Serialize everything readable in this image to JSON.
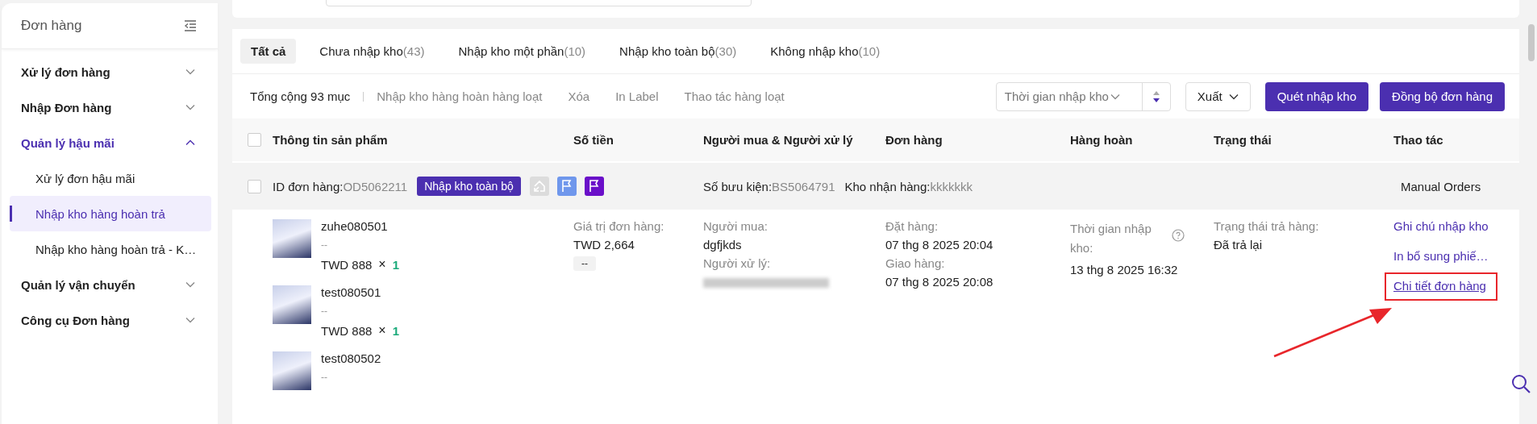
{
  "sidebar": {
    "title": "Đơn hàng",
    "groups": [
      {
        "label": "Xử lý đơn hàng",
        "expanded": false,
        "selected": false
      },
      {
        "label": "Nhập Đơn hàng",
        "expanded": false,
        "selected": false
      },
      {
        "label": "Quản lý hậu mãi",
        "expanded": true,
        "selected": true,
        "children": [
          {
            "label": "Xử lý đơn hậu mãi",
            "selected": false
          },
          {
            "label": "Nhập kho hàng hoàn trả",
            "selected": true
          },
          {
            "label": "Nhập kho hàng hoàn trả - K…",
            "selected": false
          }
        ]
      },
      {
        "label": "Quản lý vận chuyển",
        "expanded": false,
        "selected": false
      },
      {
        "label": "Công cụ Đơn hàng",
        "expanded": false,
        "selected": false
      }
    ]
  },
  "tabs": [
    {
      "label": "Tất cả",
      "selected": true
    },
    {
      "label": "Chưa nhập kho",
      "count": "(43)",
      "selected": false
    },
    {
      "label": "Nhập kho một phần",
      "count": "(10)",
      "selected": false
    },
    {
      "label": "Nhập kho toàn bộ",
      "count": "(30)",
      "selected": false
    },
    {
      "label": "Không nhập kho",
      "count": "(10)",
      "selected": false
    }
  ],
  "toolbar": {
    "total": "Tổng cộng 93 mục",
    "actions": [
      "Nhập kho hàng hoàn hàng loạt",
      "Xóa",
      "In Label",
      "Thao tác hàng loạt"
    ],
    "sort_select": "Thời gian nhập kho",
    "export": "Xuất",
    "buttons": [
      "Quét nhập kho",
      "Đồng bộ đơn hàng"
    ]
  },
  "table": {
    "header_checked": false,
    "columns": [
      "Thông tin sản phẩm",
      "Số tiền",
      "Người mua & Người xử lý",
      "Đơn hàng",
      "Hàng hoàn",
      "Trạng thái",
      "Thao tác"
    ]
  },
  "order": {
    "checked": false,
    "id_label": "ID đơn hàng:",
    "id": "OD5062211",
    "badge": "Nhập kho toàn bộ",
    "parcel_label": "Số bưu kiện:",
    "parcel": "BS5064791",
    "warehouse_label": "Kho nhận hàng:",
    "warehouse": "kkkkkkk",
    "source": "Manual Orders",
    "products": [
      {
        "name": "zuhe080501",
        "variant": "--",
        "price": "TWD 888",
        "times": "×",
        "quantity": "1"
      },
      {
        "name": "test080501",
        "variant": "--",
        "price": "TWD 888",
        "times": "×",
        "quantity": "1"
      },
      {
        "name": "test080502",
        "variant": "--"
      }
    ],
    "amount": {
      "label": "Giá trị đơn hàng:",
      "value": "TWD 2,664",
      "tag": "--"
    },
    "buyer": {
      "buyer_label": "Người mua:",
      "buyer": "dgfjkds",
      "handler_label": "Người xử lý:"
    },
    "times": [
      {
        "label": "Đặt hàng:",
        "value": "07 thg 8 2025 20:04"
      },
      {
        "label": "Giao hàng:",
        "value": "07 thg 8 2025 20:08"
      }
    ],
    "returns": {
      "label": "Thời gian nhập kho:",
      "value": "13 thg 8 2025 16:32"
    },
    "status": {
      "label": "Trạng thái trả hàng:",
      "value": "Đã trả lại"
    },
    "actions": [
      {
        "label": "Ghi chú nhập kho",
        "annotated": false
      },
      {
        "label": "In bổ sung phiế…",
        "annotated": false
      },
      {
        "label": "Chi tiết đơn hàng",
        "annotated": true
      }
    ]
  }
}
